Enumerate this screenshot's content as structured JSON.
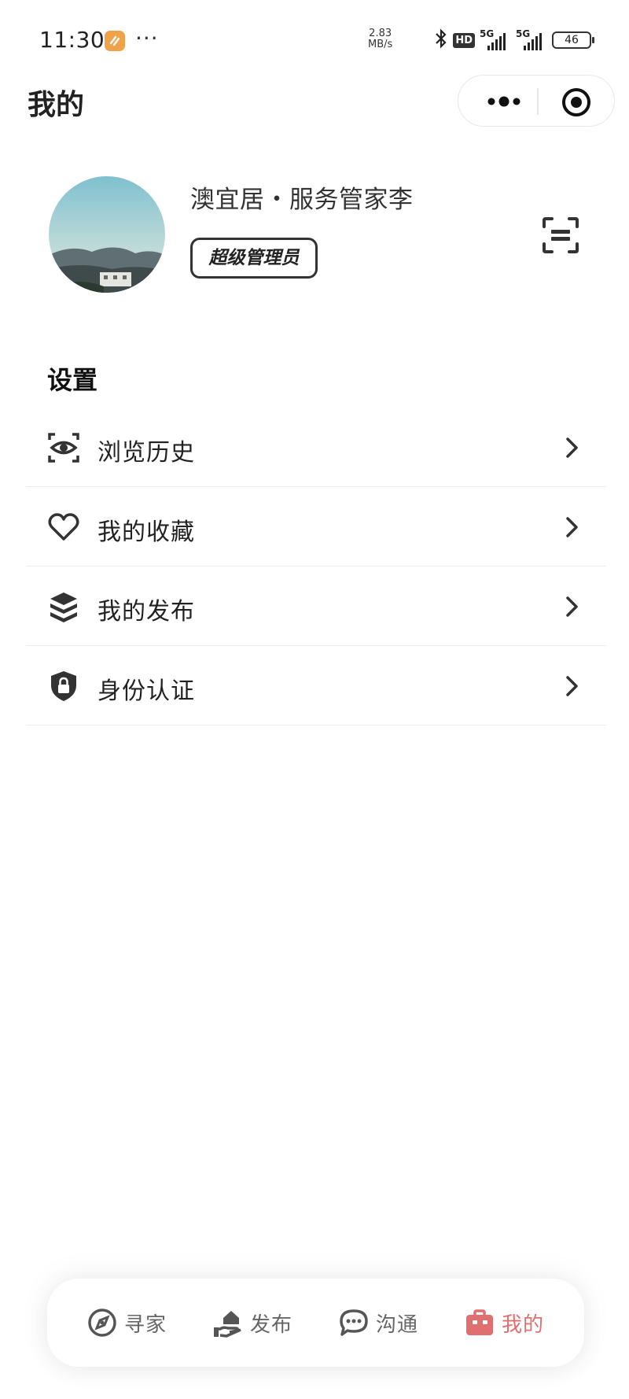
{
  "status_bar": {
    "time": "11:30",
    "dots": "···",
    "net_speed_value": "2.83",
    "net_speed_unit": "MB/s",
    "hd_label": "HD",
    "signal1_label": "5G",
    "signal2_label": "5G",
    "battery": "46"
  },
  "nav": {
    "title": "我的"
  },
  "profile": {
    "name": "澳宜居・服务管家李",
    "role_badge": "超级管理员"
  },
  "settings": {
    "title": "设置",
    "items": [
      {
        "label": "浏览历史",
        "icon": "eye-scan-icon"
      },
      {
        "label": "我的收藏",
        "icon": "heart-icon"
      },
      {
        "label": "我的发布",
        "icon": "layers-icon"
      },
      {
        "label": "身份认证",
        "icon": "shield-lock-icon"
      }
    ]
  },
  "tabbar": {
    "tabs": [
      {
        "label": "寻家",
        "icon": "compass-icon",
        "active": false
      },
      {
        "label": "发布",
        "icon": "hand-house-icon",
        "active": false
      },
      {
        "label": "沟通",
        "icon": "chat-bubble-icon",
        "active": false
      },
      {
        "label": "我的",
        "icon": "briefcase-icon",
        "active": true
      }
    ],
    "active_color": "#e07070",
    "inactive_color": "#666666"
  }
}
